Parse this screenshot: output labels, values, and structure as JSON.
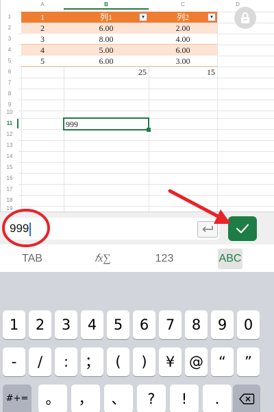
{
  "sheet": {
    "columns": [
      "A",
      "B",
      "C",
      "D"
    ],
    "active_column": "B",
    "rows": [
      "1",
      "2",
      "3",
      "4",
      "5",
      "6",
      "7",
      "8",
      "9",
      "10",
      "11",
      "12",
      "13",
      "14",
      "15",
      "16",
      "17",
      "18",
      "19"
    ],
    "active_row": "11",
    "table": {
      "header": [
        "1",
        "列1",
        "列2"
      ],
      "filter_icon": "dropdown-filter-icon",
      "body": [
        [
          "2",
          "6.00",
          "2.00"
        ],
        [
          "3",
          "8.00",
          "4.00"
        ],
        [
          "4",
          "5.00",
          "6.00"
        ],
        [
          "5",
          "6.00",
          "3.00"
        ]
      ],
      "totals": [
        "25",
        "15"
      ],
      "colors": {
        "header": "#ef7d31",
        "band": "#fce3d4"
      }
    },
    "selected_cell_value": "999",
    "lock_icon": "lock-icon"
  },
  "input_bar": {
    "value": "999",
    "enter_icon": "return-arrow-icon",
    "confirm_icon": "checkmark-icon",
    "accent": "#1e7d45"
  },
  "mode_tabs": {
    "tab": "TAB",
    "fx": "𝑓x∑",
    "num": "123",
    "abc": "ABC",
    "active": "ABC"
  },
  "keyboard": {
    "row1": [
      "1",
      "2",
      "3",
      "4",
      "5",
      "6",
      "7",
      "8",
      "9",
      "0"
    ],
    "row2": [
      "-",
      "/",
      ":",
      "；",
      "(",
      ")",
      "¥",
      "@",
      "“",
      "”"
    ],
    "row3_left": "#+=",
    "row3": [
      "。",
      "，",
      "、",
      "?",
      "!",
      "."
    ],
    "backspace_icon": "backspace-icon"
  },
  "annotation": {
    "color": "#e8232a"
  }
}
